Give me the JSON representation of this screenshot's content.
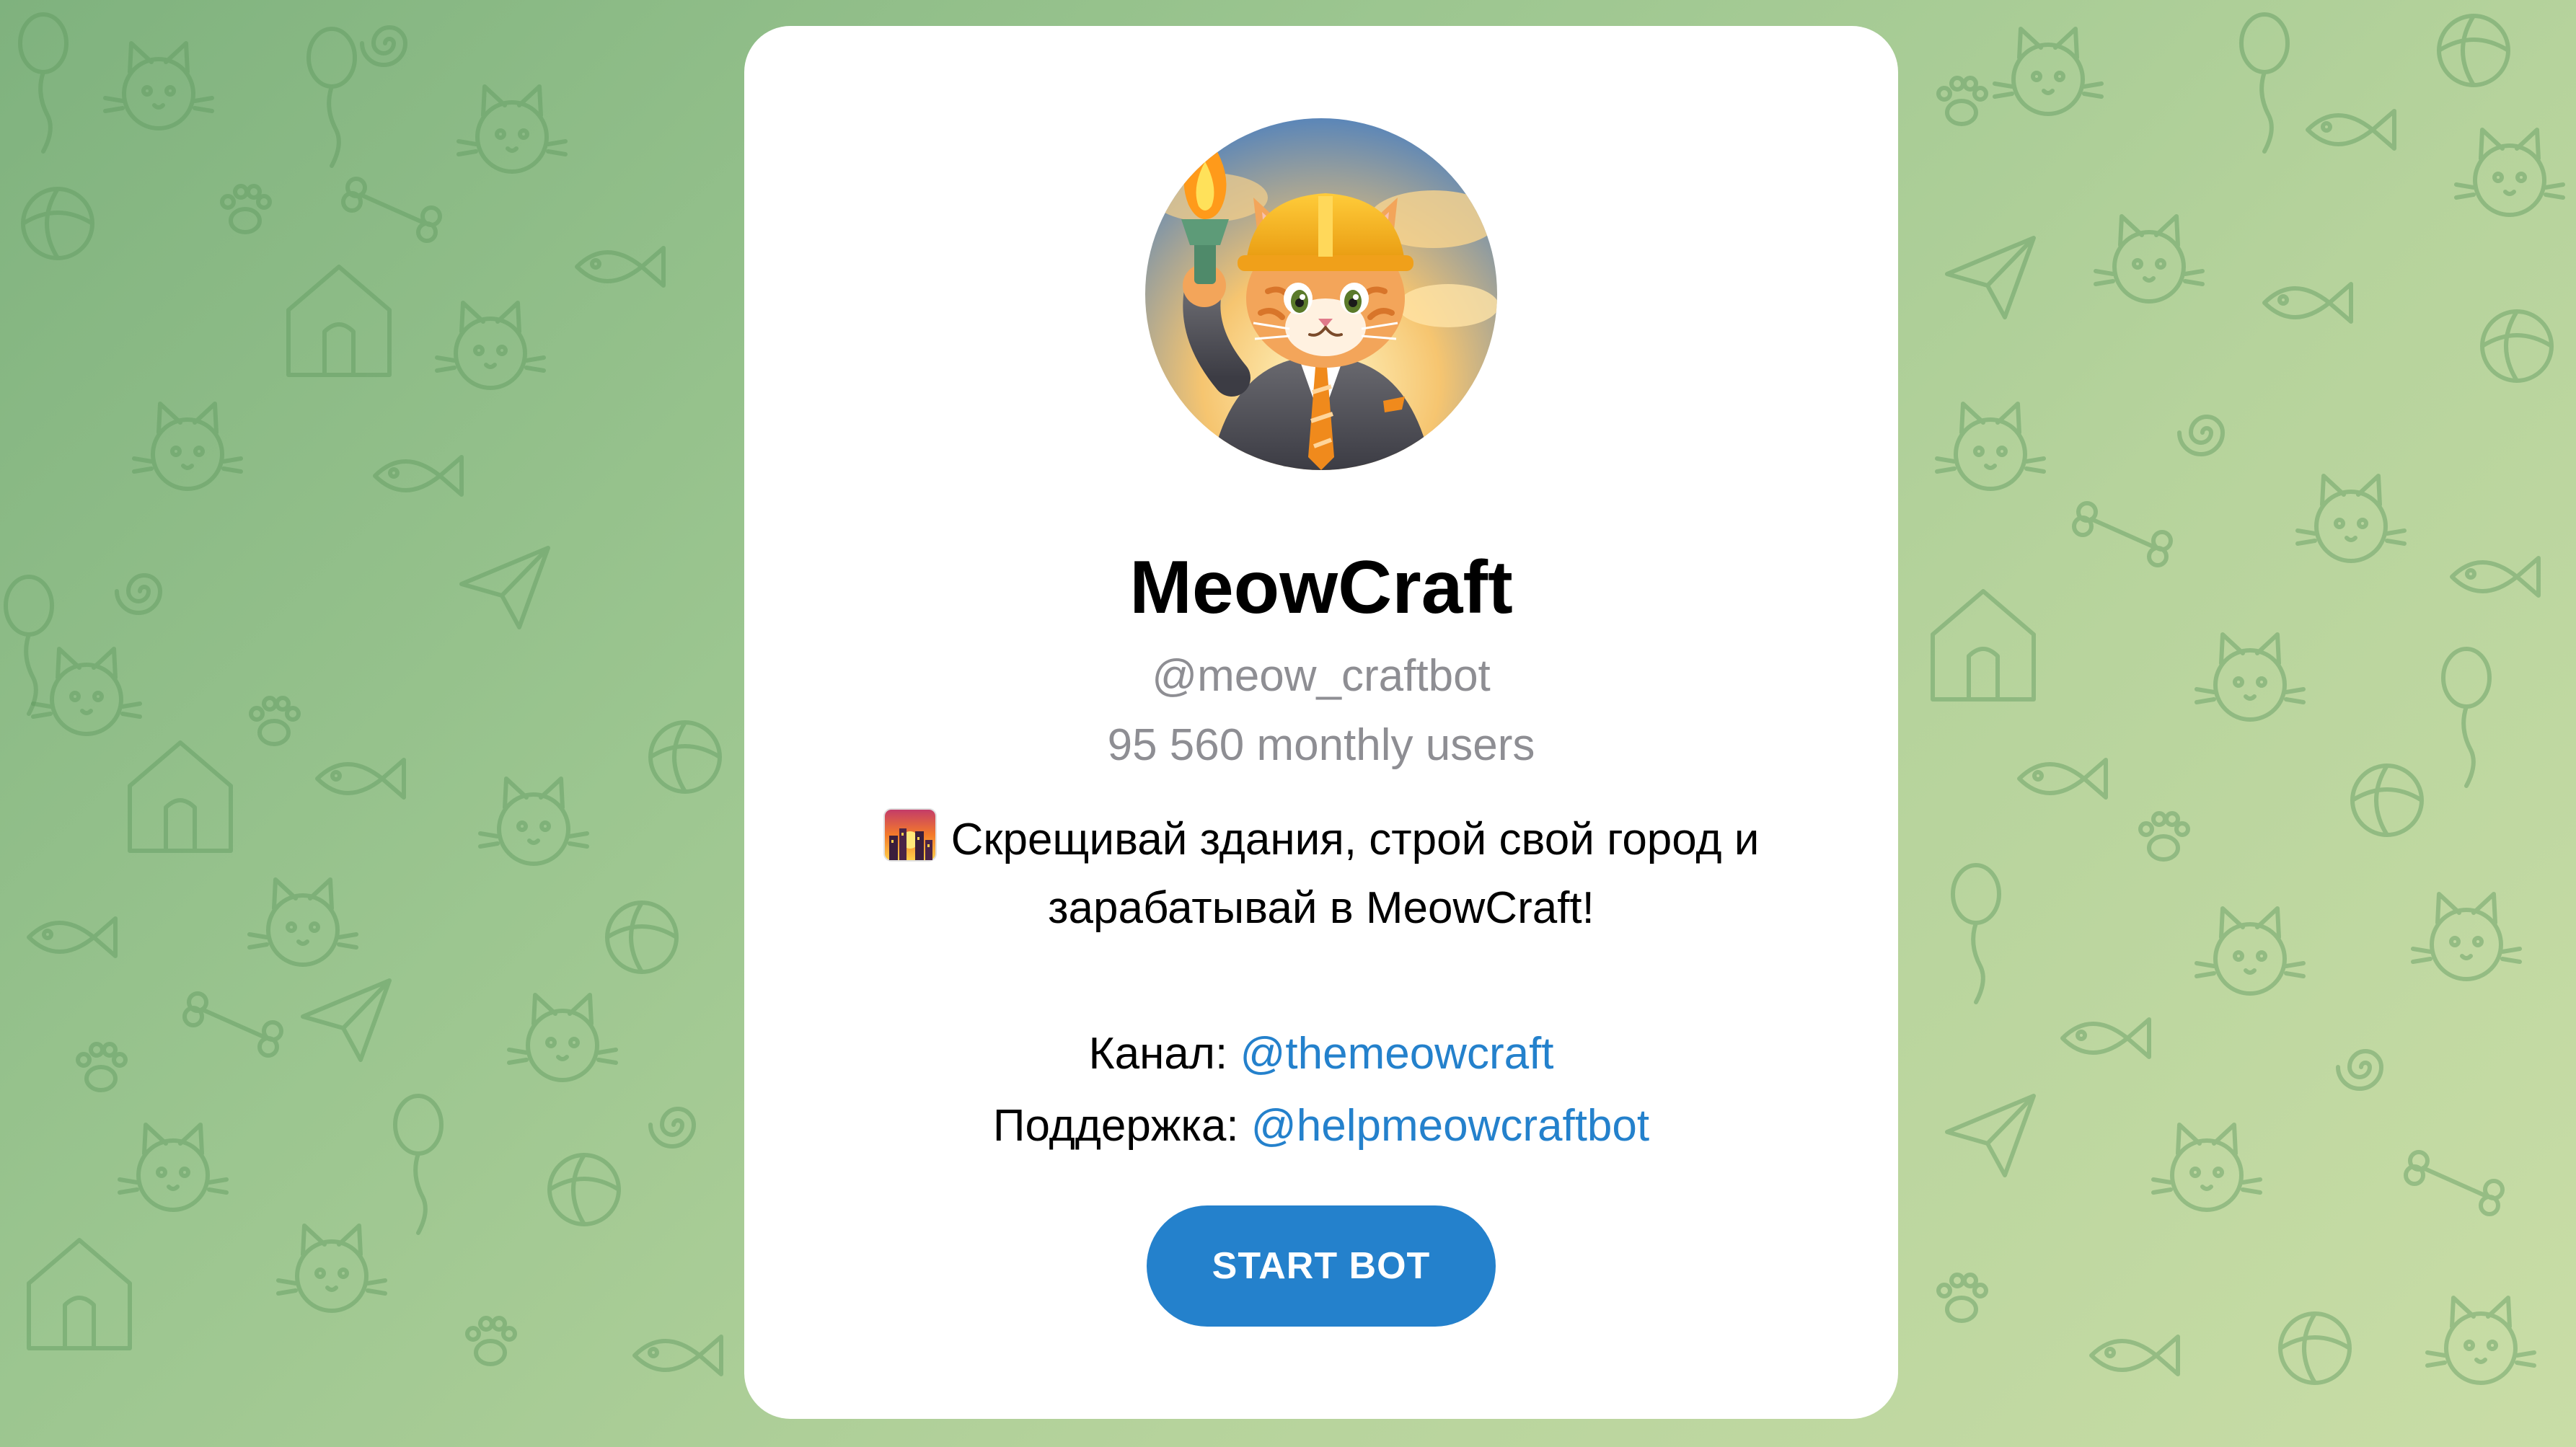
{
  "background": {
    "pattern": "telegram-doodle-cats",
    "colors": [
      "#7fb27e",
      "#9cc690",
      "#b6d39c",
      "#c9dda6"
    ]
  },
  "bot": {
    "avatar_icon": "cat-in-hardhat-with-torch",
    "name": "MeowCraft",
    "username": "@meow_craftbot",
    "monthly_users": "95 560 monthly users"
  },
  "description": {
    "emoji_icon": "cityscape-at-sunset-emoji",
    "line1": "Скрещивай здания, строй свой город и",
    "line2": "зарабатывай в MeowCraft!"
  },
  "links": {
    "channel_label": "Канал:",
    "channel_handle": "@themeowcraft",
    "support_label": "Поддержка:",
    "support_handle": "@helpmeowcraftbot"
  },
  "actions": {
    "start_label": "START BOT"
  },
  "colors": {
    "accent": "#2481cc",
    "muted_text": "#8e8e93"
  }
}
